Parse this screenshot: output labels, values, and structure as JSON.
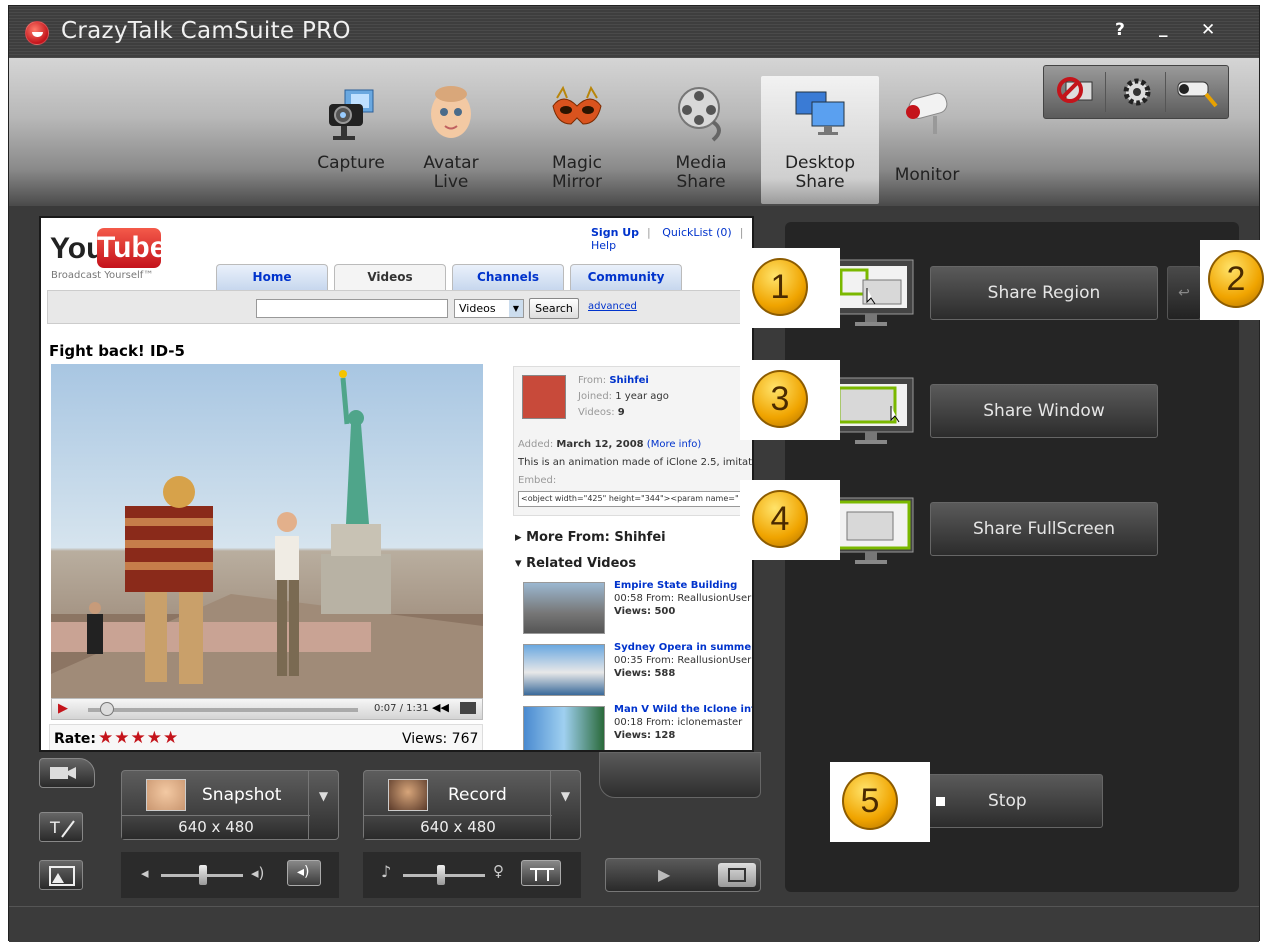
{
  "window": {
    "title": "CrazyTalk CamSuite PRO",
    "help_label": "?",
    "minimize_label": "_",
    "close_label": "✕"
  },
  "nav": [
    {
      "label": "Capture"
    },
    {
      "label": "Avatar\nLive"
    },
    {
      "label": "Magic\nMirror"
    },
    {
      "label": "Media\nShare"
    },
    {
      "label": "Desktop\nShare",
      "active": true
    },
    {
      "label": "Monitor"
    }
  ],
  "preview": {
    "youtube": {
      "logo_you": "You",
      "logo_tube": "Tube",
      "tagline": "Broadcast Yourself™",
      "top_links": [
        "Sign Up",
        "QuickList (0)",
        "Help"
      ],
      "tabs": [
        "Home",
        "Videos",
        "Channels",
        "Community"
      ],
      "search_select": "Videos",
      "search_button": "Search",
      "advanced_link": "advanced",
      "video_title": "Fight back! ID-5",
      "time": "0:07 / 1:31",
      "rate_label": "Rate:",
      "views_label": "Views: 767",
      "info": {
        "from_label": "From:",
        "from_user": "Shihfei",
        "joined_label": "Joined:",
        "joined_value": "1 year ago",
        "videos_label": "Videos:",
        "videos_value": "9",
        "added_label": "Added:",
        "added_value": "March 12, 2008",
        "more_info": "(More info)",
        "description": "This is an animation made of iClone 2.5, imitat",
        "embed_label": "Embed:",
        "embed_code": "<object width=\"425\" height=\"344\"><param name=\""
      },
      "more_from": "More From: Shihfei",
      "related_heading": "Related Videos",
      "related": [
        {
          "title": "Empire State Building",
          "meta": "00:58 From: ReallusionUser",
          "views": "Views: 500"
        },
        {
          "title": "Sydney Opera in summer",
          "meta": "00:35 From: ReallusionUser",
          "views": "Views: 588"
        },
        {
          "title": "Man V Wild the Iclone intro",
          "meta": "00:18 From: iclonemaster",
          "views": "Views: 128"
        }
      ]
    }
  },
  "capture": {
    "snapshot_label": "Snapshot",
    "snapshot_res": "640 x 480",
    "record_label": "Record",
    "record_res": "640 x 480"
  },
  "share": {
    "region_label": "Share Region",
    "window_label": "Share Window",
    "fullscreen_label": "Share FullScreen",
    "stop_label": "Stop",
    "callouts": [
      "1",
      "2",
      "3",
      "4",
      "5"
    ]
  },
  "colors": {
    "accent_red": "#c4141b",
    "callout_gold": "#f0a400",
    "panel_dark": "#252525",
    "youtube_link": "#0033cc"
  }
}
